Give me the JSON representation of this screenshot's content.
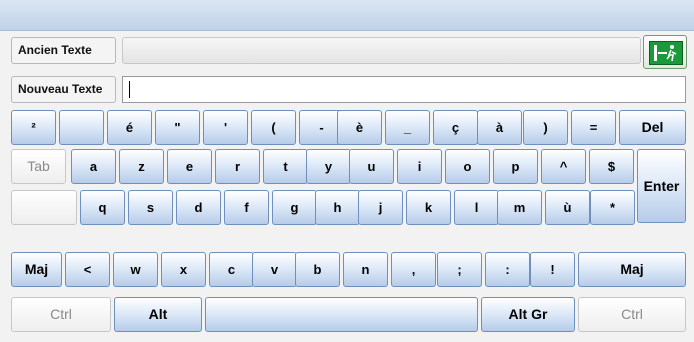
{
  "window": {
    "title": ""
  },
  "fields": {
    "old_label": "Ancien Texte",
    "old_value": "",
    "new_label": "Nouveau Texte",
    "new_value": ""
  },
  "exit": {
    "icon": "exit-door-icon",
    "color": "#1a9a3a"
  },
  "keyboard": {
    "row1": [
      "²",
      "",
      "é",
      "\"",
      "'",
      "(",
      "-",
      "è",
      "_",
      "ç",
      "à",
      ")",
      "=",
      "Del"
    ],
    "row2": [
      "Tab",
      "a",
      "z",
      "e",
      "r",
      "t",
      "y",
      "u",
      "i",
      "o",
      "p",
      "^",
      "$",
      "Enter"
    ],
    "row3": [
      "",
      "q",
      "s",
      "d",
      "f",
      "g",
      "h",
      "j",
      "k",
      "l",
      "m",
      "ù",
      "*"
    ],
    "row4": [
      "Maj",
      "<",
      "w",
      "x",
      "c",
      "v",
      "b",
      "n",
      ",",
      ";",
      ":",
      "!",
      "Maj"
    ],
    "row5": [
      "Ctrl",
      "Alt",
      "",
      "Alt Gr",
      "Ctrl"
    ]
  }
}
